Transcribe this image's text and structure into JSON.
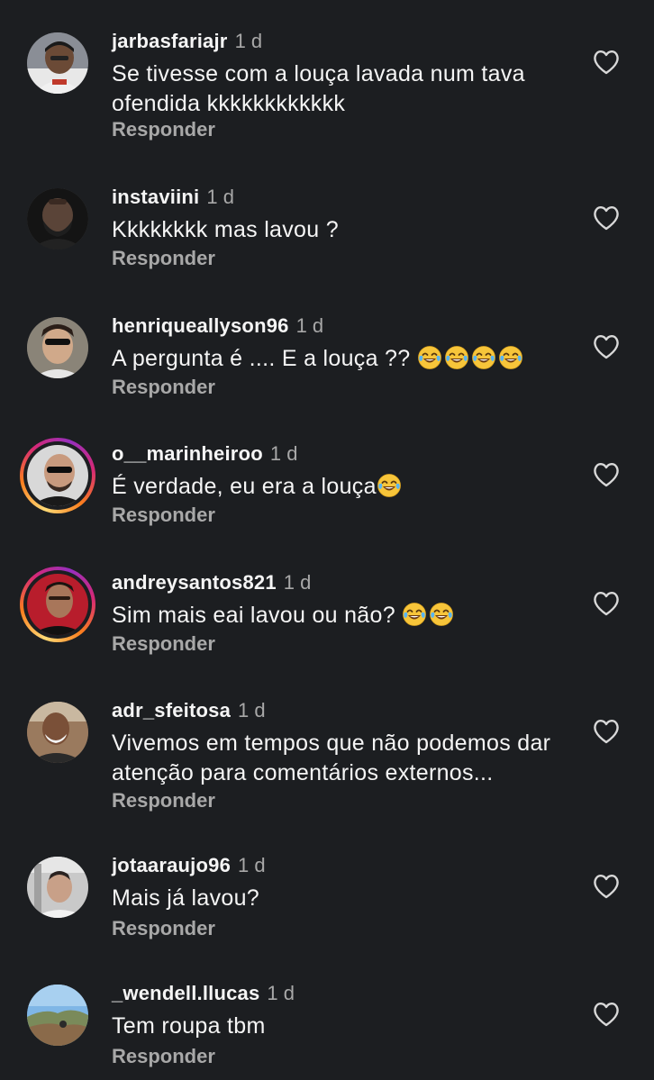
{
  "comments": [
    {
      "username": "jarbasfariajr",
      "time": "1 d",
      "text": "Se tivesse com a louça lavada num tava ofendida kkkkkkkkkkkk",
      "reply": "Responder",
      "emoji_count": 0,
      "has_story_ring": false
    },
    {
      "username": "instaviini",
      "time": "1 d",
      "text": "Kkkkkkkk mas lavou ?",
      "reply": "Responder",
      "emoji_count": 0,
      "has_story_ring": false
    },
    {
      "username": "henriqueallyson96",
      "time": "1 d",
      "text": "A pergunta é .... E a louça ?? ",
      "reply": "Responder",
      "emoji_count": 4,
      "has_story_ring": false
    },
    {
      "username": "o__marinheiroo",
      "time": "1 d",
      "text": "É verdade, eu era a louça",
      "reply": "Responder",
      "emoji_count": 1,
      "has_story_ring": true
    },
    {
      "username": "andreysantos821",
      "time": "1 d",
      "text": "Sim mais eai lavou ou não? ",
      "reply": "Responder",
      "emoji_count": 2,
      "has_story_ring": true
    },
    {
      "username": "adr_sfeitosa",
      "time": "1 d",
      "text": "Vivemos em tempos que não podemos dar atenção para comentários externos...",
      "reply": "Responder",
      "emoji_count": 0,
      "has_story_ring": false
    },
    {
      "username": "jotaaraujo96",
      "time": "1 d",
      "text": "Mais já lavou?",
      "reply": "Responder",
      "emoji_count": 0,
      "has_story_ring": false
    },
    {
      "username": "_wendell.llucas",
      "time": "1 d",
      "text": "Tem roupa tbm",
      "reply": "Responder",
      "emoji_count": 0,
      "has_story_ring": false
    }
  ],
  "icons": {
    "like": "heart-outline-icon",
    "emoji": "face-with-tears-of-joy-emoji"
  },
  "colors": {
    "background": "#1c1e21",
    "text_primary": "#f5f5f5",
    "text_secondary": "#a8a8a8"
  }
}
